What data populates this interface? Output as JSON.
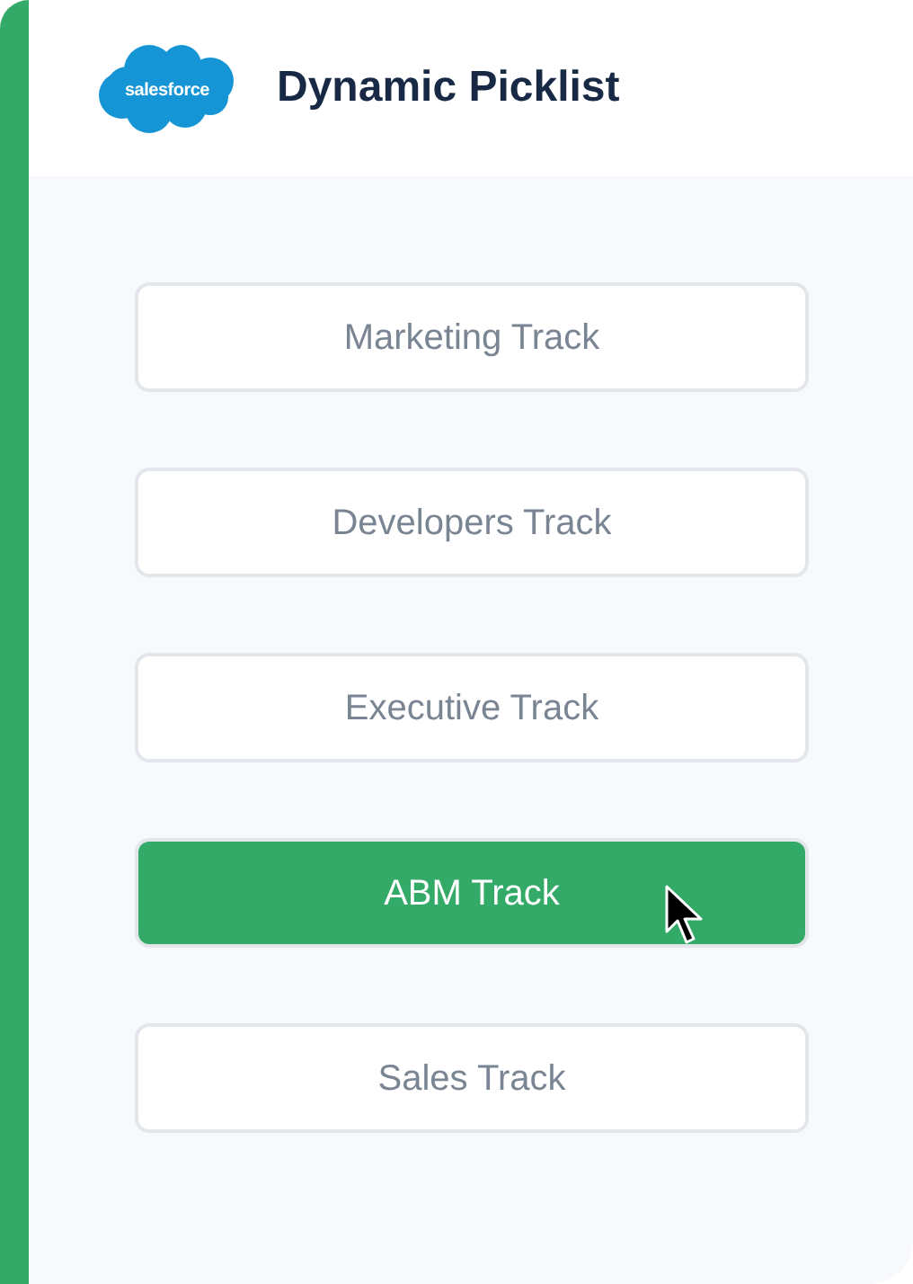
{
  "header": {
    "logo_text": "salesforce",
    "title": "Dynamic Picklist"
  },
  "options": [
    {
      "label": "Marketing Track",
      "selected": false,
      "hovered": false
    },
    {
      "label": "Developers Track",
      "selected": false,
      "hovered": false
    },
    {
      "label": "Executive Track",
      "selected": false,
      "hovered": false
    },
    {
      "label": "ABM Track",
      "selected": true,
      "hovered": true
    },
    {
      "label": "Sales Track",
      "selected": false,
      "hovered": false
    }
  ]
}
